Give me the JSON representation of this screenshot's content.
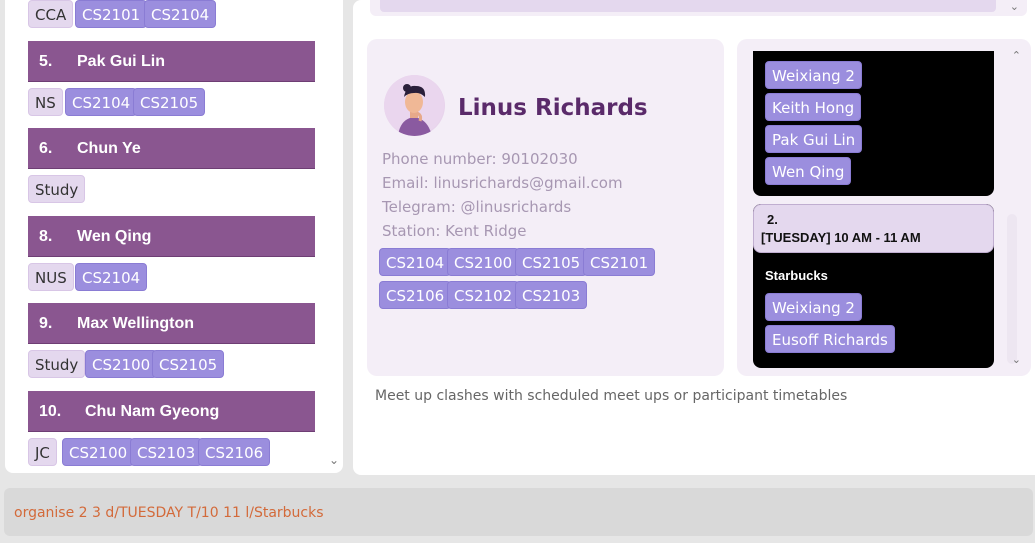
{
  "left_list": {
    "top_tags": [
      "CCA",
      "CS2101",
      "CS2104"
    ],
    "persons": [
      {
        "index": "5.",
        "name": "Pak Gui Lin",
        "tags": [
          "NS"
        ],
        "modules": [
          "CS2104",
          "CS2105"
        ]
      },
      {
        "index": "6.",
        "name": "Chun Ye",
        "tags": [
          "Study"
        ],
        "modules": []
      },
      {
        "index": "8.",
        "name": "Wen Qing",
        "tags": [
          "NUS"
        ],
        "modules": [
          "CS2104"
        ]
      },
      {
        "index": "9.",
        "name": "Max Wellington",
        "tags": [
          "Study"
        ],
        "modules": [
          "CS2100",
          "CS2105"
        ]
      },
      {
        "index": "10.",
        "name": "Chu Nam Gyeong",
        "tags": [
          "JC"
        ],
        "modules": [
          "CS2100",
          "CS2103",
          "CS2106"
        ]
      }
    ]
  },
  "profile": {
    "name": "Linus Richards",
    "phone": "Phone number: 90102030",
    "email": "Email: linusrichards@gmail.com",
    "telegram": "Telegram: @linusrichards",
    "station": "Station: Kent Ridge",
    "modules": [
      "CS2104",
      "CS2100",
      "CS2105",
      "CS2101",
      "CS2106",
      "CS2102",
      "CS2103"
    ]
  },
  "meetups": {
    "first_participants": [
      "Weixiang 2",
      "Keith Hong",
      "Pak Gui Lin",
      "Wen Qing"
    ],
    "second": {
      "index": "2.",
      "time": "[TUESDAY] 10 AM - 11 AM",
      "venue": "Starbucks",
      "participants": [
        "Weixiang 2",
        "Eusoff Richards"
      ]
    }
  },
  "status_message": "Meet up clashes with scheduled meet ups or participant timetables",
  "command": {
    "value": "organise 2 3 d/TUESDAY T/10 11 l/Starbucks"
  },
  "colors": {
    "header_purple": "#8a5690",
    "module_tag": "#9b8ede",
    "light_tag": "#e4d8ee",
    "command_text": "#d36a3a"
  }
}
